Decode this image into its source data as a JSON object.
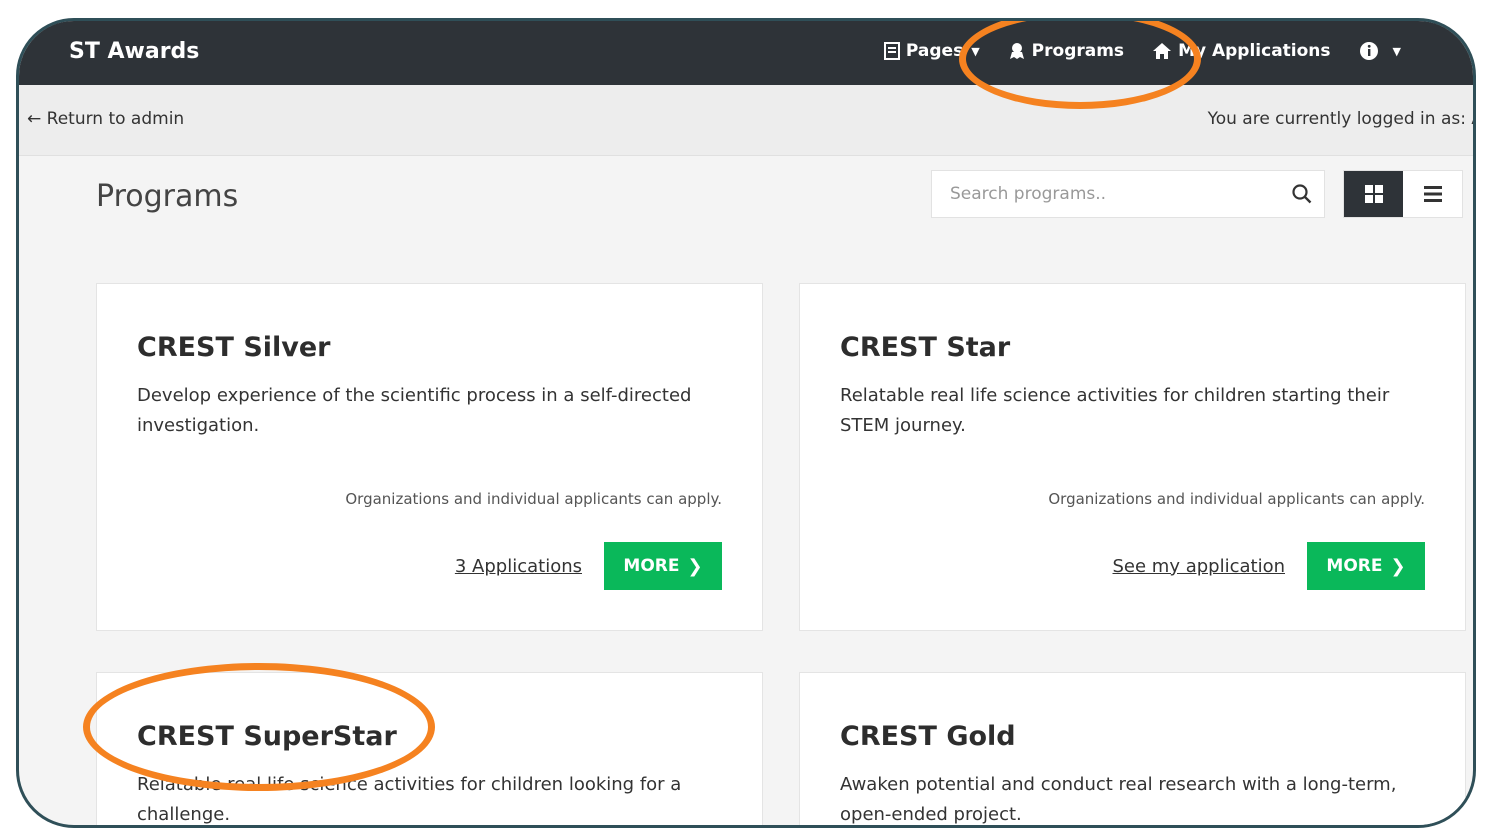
{
  "header": {
    "brand": "ST Awards",
    "nav": [
      {
        "label": "Pages",
        "icon": "page-icon",
        "caret": true
      },
      {
        "label": "Programs",
        "icon": "programs-icon",
        "caret": false
      },
      {
        "label": "My Applications",
        "icon": "home-icon",
        "caret": false
      },
      {
        "label": "",
        "icon": "info-icon",
        "caret": true
      }
    ]
  },
  "subbar": {
    "return_label": "← Return to admin",
    "logged_in": "You are currently logged in as: A"
  },
  "main": {
    "title": "Programs",
    "search_placeholder": "Search programs.."
  },
  "cards": [
    {
      "title": "CREST Silver",
      "description": "Develop experience of the scientific process in a self-directed investigation.",
      "note": "Organizations and individual applicants can apply.",
      "link": "3 Applications",
      "button": "MORE"
    },
    {
      "title": "CREST Star",
      "description": "Relatable real life science activities for children starting their STEM journey.",
      "note": "Organizations and individual applicants can apply.",
      "link": "See my application",
      "button": "MORE"
    },
    {
      "title": "CREST SuperStar",
      "description": "Relatable real life science activities for  children looking for a challenge."
    },
    {
      "title": "CREST Gold",
      "description": "Awaken potential and conduct real research with a long-term, open-ended project."
    }
  ],
  "colors": {
    "nav_bg": "#2e3338",
    "button_green": "#0ab85a",
    "highlight_orange": "#f58220",
    "frame_border": "#2f4f58"
  }
}
